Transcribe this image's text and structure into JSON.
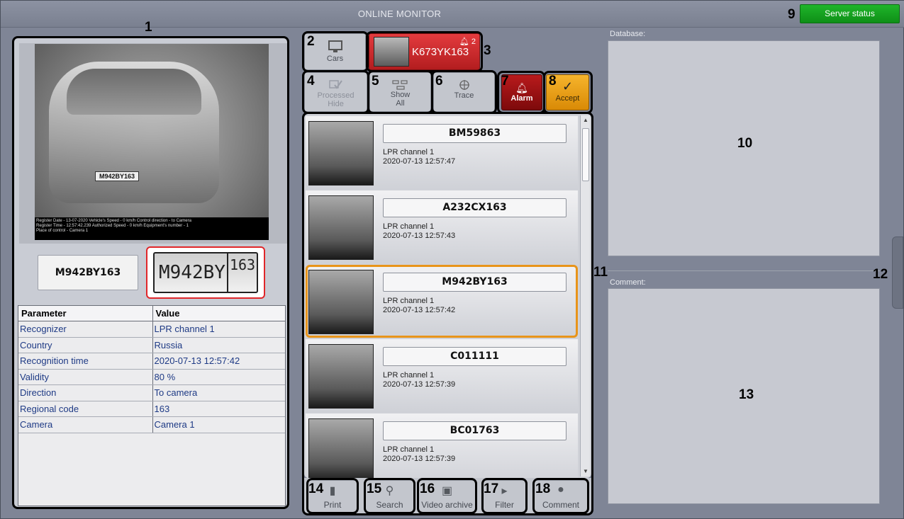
{
  "window": {
    "title": "ONLINE MONITOR",
    "server_status_label": "Server status"
  },
  "callouts": [
    "1",
    "2",
    "3",
    "4",
    "5",
    "6",
    "7",
    "8",
    "9",
    "10",
    "11",
    "12",
    "13",
    "14",
    "15",
    "16",
    "17",
    "18"
  ],
  "left_panel": {
    "recognized_plate": "M942BY163",
    "plate_image_text": "M942BY",
    "plate_image_region": "163",
    "frame_overlay": [
      "Register Date - 13-07-2020    Vehicle's Speed - 0 km/h  Control direction - to Camera",
      "Register Time - 12:57:42.239   Authorized Speed - 0 km/h     Equipment's number - 1",
      "Place of control - Camera 1"
    ],
    "frame_plate": "M942BY163",
    "params": {
      "headers": [
        "Parameter",
        "Value"
      ],
      "rows": [
        [
          "Recognizer",
          "LPR channel  1"
        ],
        [
          "Country",
          "Russia"
        ],
        [
          "Recognition time",
          "2020-07-13 12:57:42"
        ],
        [
          "Validity",
          "80 %"
        ],
        [
          "Direction",
          "To camera"
        ],
        [
          "Regional code",
          "163"
        ],
        [
          "Camera",
          "Camera 1"
        ]
      ]
    }
  },
  "toolbar": {
    "cars_label": "Cars",
    "alert_plate": "K673YK163",
    "alert_count": "2",
    "processed_line1": "Processed",
    "processed_line2": "Hide",
    "show_line1": "Show",
    "show_line2": "All",
    "trace_label": "Trace",
    "alarm_label": "Alarm",
    "accept_label": "Accept"
  },
  "events": [
    {
      "plate": "BM59863",
      "channel": "LPR channel  1",
      "time": "2020-07-13 12:57:47",
      "selected": false
    },
    {
      "plate": "A232CX163",
      "channel": "LPR channel  1",
      "time": "2020-07-13 12:57:43",
      "selected": false
    },
    {
      "plate": "M942BY163",
      "channel": "LPR channel  1",
      "time": "2020-07-13 12:57:42",
      "selected": true
    },
    {
      "plate": "C011111",
      "channel": "LPR channel  1",
      "time": "2020-07-13 12:57:39",
      "selected": false
    },
    {
      "plate": "BC01763",
      "channel": "LPR channel  1",
      "time": "2020-07-13 12:57:39",
      "selected": false
    }
  ],
  "bottom_buttons": {
    "print": "Print",
    "search": "Search",
    "video_archive": "Video archive",
    "filter": "Filter",
    "comment": "Comment"
  },
  "right": {
    "database_label": "Database:",
    "comment_label": "Comment:"
  },
  "colors": {
    "server_status": "#17a822",
    "alert": "#d12e31",
    "alarm": "#9b1012",
    "accept": "#eda11a",
    "selection": "#e8941a",
    "param_value": "#1e3a85"
  }
}
